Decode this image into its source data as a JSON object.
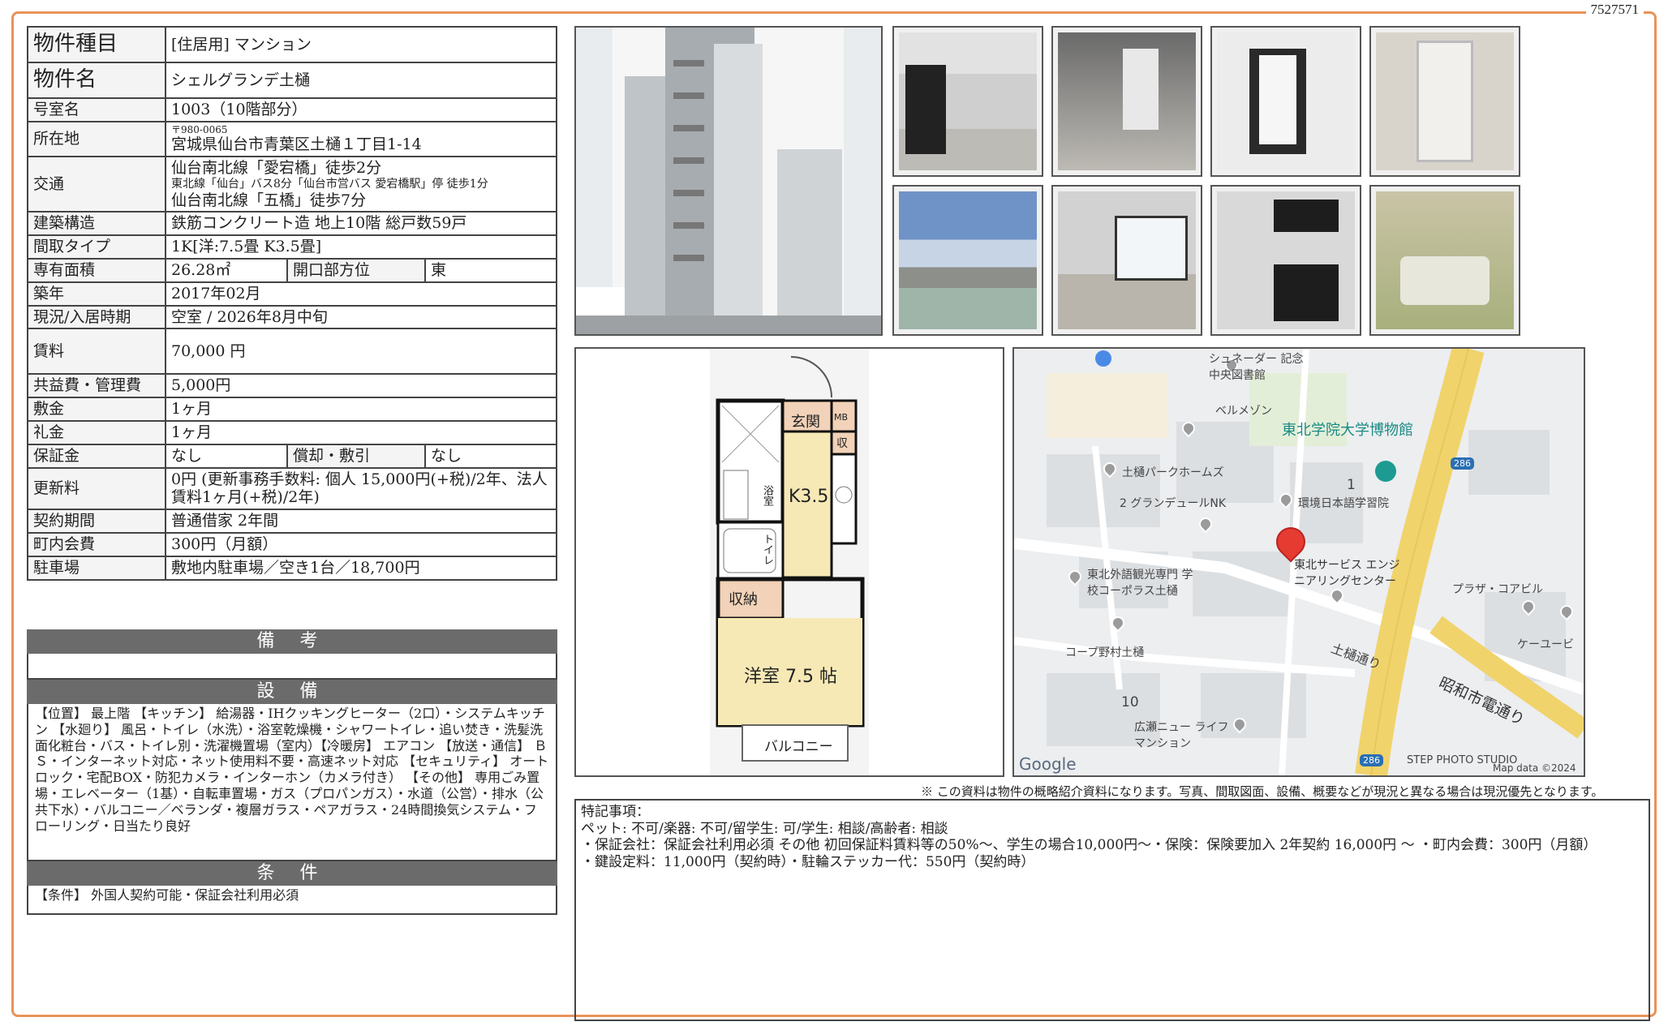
{
  "doc_id": "7527571",
  "rows": {
    "type": {
      "label": "物件種目",
      "value": "[住居用]  マンション"
    },
    "name": {
      "label": "物件名",
      "value": "シェルグランデ土樋"
    },
    "room": {
      "label": "号室名",
      "value": "1003（10階部分）"
    },
    "address": {
      "label": "所在地",
      "postal": "〒980-0065",
      "value": "宮城県仙台市青葉区土樋１丁目1-14"
    },
    "access": {
      "label": "交通",
      "lines": [
        "仙台南北線「愛宕橋」徒歩2分",
        "東北線「仙台」バス8分「仙台市営バス 愛宕橋駅」停 徒歩1分",
        "仙台南北線「五橋」徒歩7分"
      ]
    },
    "structure": {
      "label": "建築構造",
      "value": "鉄筋コンクリート造  地上10階  総戸数59戸"
    },
    "layout": {
      "label": "間取タイプ",
      "value": "1K[洋:7.5畳  K3.5畳]"
    },
    "area": {
      "label": "専有面積",
      "value": "26.28㎡",
      "dir_label": "開口部方位",
      "dir_value": "東"
    },
    "built": {
      "label": "築年",
      "value": "2017年02月"
    },
    "status": {
      "label": "現況/入居時期",
      "value": "空室  /   2026年8月中旬"
    },
    "rent": {
      "label": "賃料",
      "value": "70,000 円"
    },
    "fee": {
      "label": "共益費・管理費",
      "value": "5,000円"
    },
    "deposit": {
      "label": "敷金",
      "value": "1ヶ月"
    },
    "key_money": {
      "label": "礼金",
      "value": "1ヶ月"
    },
    "guarantee": {
      "label": "保証金",
      "value": "なし",
      "amort_label": "償却・敷引",
      "amort_value": "なし"
    },
    "renewal": {
      "label": "更新料",
      "value": "0円  (更新事務手数料: 個人 15,000円(+税)/2年、法人 賃料1ヶ月(+税)/2年)"
    },
    "contract": {
      "label": "契約期間",
      "value": "普通借家  2年間"
    },
    "town": {
      "label": "町内会費",
      "value": "300円（月額）"
    },
    "parking": {
      "label": "駐車場",
      "value": "敷地内駐車場／空き1台／18,700円"
    }
  },
  "sections": {
    "remarks_title": "備 考",
    "equip_title": "設 備",
    "equip_text": "【位置】 最上階 【キッチン】 給湯器・IHクッキングヒーター（2口）・システムキッチン 【水廻り】 風呂・トイレ（水洗）・浴室乾燥機・シャワートイレ・追い焚き・洗髪洗面化粧台・バス・トイレ別・洗濯機置場（室内）【冷暖房】 エアコン 【放送・通信】 ＢＳ・インターネット対応・ネット使用料不要・高速ネット対応 【セキュリティ】 オートロック・宅配BOX・防犯カメラ・インターホン（カメラ付き） 【その他】 専用ごみ置場・エレベーター（1基）・自転車置場・ガス（プロパンガス）・水道（公営）・排水（公共下水）・バルコニー／ベランダ・複層ガラス・ペアガラス・24時間換気システム・フローリング・日当たり良好",
    "cond_title": "条 件",
    "cond_text": "【条件】 外国人契約可能・保証会社利用必須"
  },
  "floorplan": {
    "entrance": "玄関",
    "mb": "MB",
    "storage_small": "収",
    "kitchen": "K3.5",
    "bath": "浴室",
    "toilet": "トイレ",
    "closet": "収納",
    "room": "洋室 7.5 帖",
    "balcony": "バルコニー"
  },
  "map": {
    "labels": [
      "シュネーダー 記念中央図書館",
      "ベルメゾン",
      "東北学院大学博物館",
      "土樋パークホームズ",
      "2 グランデュールNK",
      "1",
      "環境日本語学習院",
      "東北サービス エンジニアリングセンター",
      "東北外語観光専門 学校コーポラス土樋",
      "プラザ・コアビル",
      "コープ野村土樋",
      "ケーユービ",
      "土樋通り",
      "昭和市電通り",
      "10",
      "広瀬ニュー ライフマンション",
      "STEP PHOTO STUDIO",
      "Map data ©2024",
      "286",
      "286"
    ],
    "google": "Google"
  },
  "notice": "※ この資料は物件の概略紹介資料になります。写真、間取図面、設備、概要などが現況と異なる場合は現況優先となります。",
  "special": {
    "title": "特記事項：",
    "lines": [
      "ペット: 不可/楽器: 不可/留学生: 可/学生: 相談/高齢者: 相談",
      "・保証会社：保証会社利用必須 その他 初回保証料賃料等の50%～、学生の場合10,000円～・保険：保険要加入 2年契約 16,000円 ～ ・町内会費：300円（月額）",
      "・鍵設定料：11,000円（契約時）・駐輪ステッカー代：550円（契約時）"
    ]
  }
}
